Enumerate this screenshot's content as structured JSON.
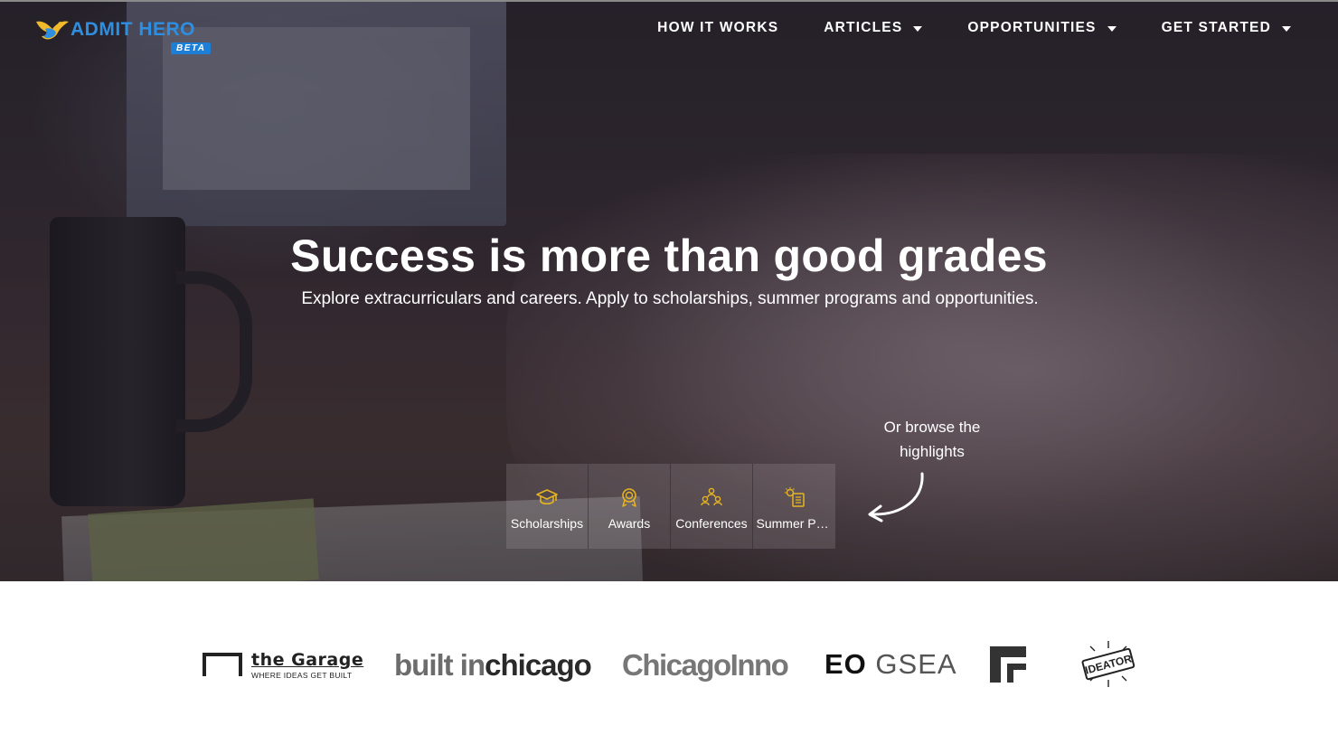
{
  "brand": {
    "name": "ADMIT HERO",
    "badge": "BETA",
    "color": "#2e8ee0"
  },
  "nav": {
    "items": [
      {
        "label": "HOW IT WORKS",
        "has_dropdown": false
      },
      {
        "label": "ARTICLES",
        "has_dropdown": true
      },
      {
        "label": "OPPORTUNITIES",
        "has_dropdown": true
      },
      {
        "label": "GET STARTED",
        "has_dropdown": true
      }
    ]
  },
  "hero": {
    "headline": "Success is more than good grades",
    "subline": "Explore extracurriculars and careers. Apply to scholarships, summer programs and opportunities.",
    "browse_hint": "Or browse the highlights"
  },
  "highlights": [
    {
      "label": "Scholarships",
      "icon": "graduation-cap-icon"
    },
    {
      "label": "Awards",
      "icon": "award-medal-icon"
    },
    {
      "label": "Conferences",
      "icon": "people-group-icon"
    },
    {
      "label": "Summer Programs",
      "icon": "sun-clipboard-icon"
    }
  ],
  "accent_color": "#e6b422",
  "partners": {
    "garage": {
      "name": "the Garage",
      "tagline": "WHERE IDEAS GET BUILT"
    },
    "builtin": {
      "part1": "built in",
      "part2": "chicago"
    },
    "chicagoinno": {
      "name": "ChicagoInno"
    },
    "eogsea": {
      "part1": "EO",
      "part2": "GSEA"
    },
    "flogo": {
      "icon": "f-block-logo-icon"
    },
    "ideator": {
      "name": "IDEATOR"
    }
  }
}
